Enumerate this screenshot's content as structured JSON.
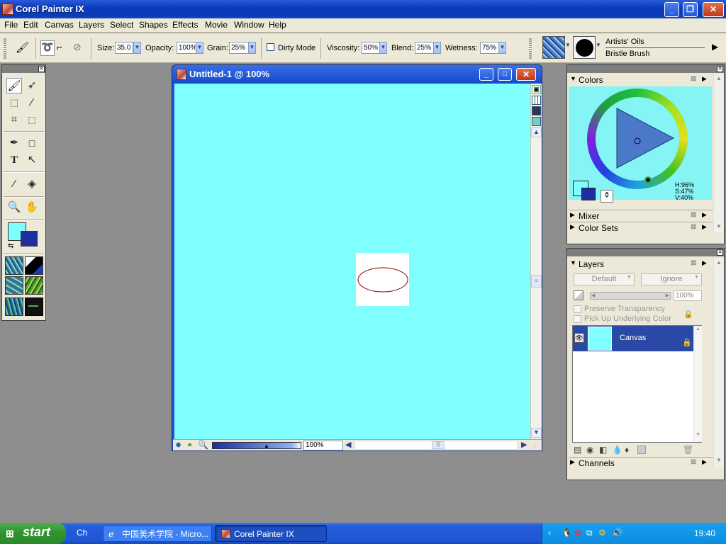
{
  "app": {
    "title": "Corel Painter IX"
  },
  "menu": [
    "File",
    "Edit",
    "Canvas",
    "Layers",
    "Select",
    "Shapes",
    "Effects",
    "Movie",
    "Window",
    "Help"
  ],
  "property_bar": {
    "size_label": "Size:",
    "size_value": "35.0",
    "opacity_label": "Opacity:",
    "opacity_value": "100%",
    "grain_label": "Grain:",
    "grain_value": "25%",
    "dirty_mode_label": "Dirty Mode",
    "viscosity_label": "Viscosity:",
    "viscosity_value": "50%",
    "blend_label": "Blend:",
    "blend_value": "25%",
    "wetness_label": "Wetness:",
    "wetness_value": "75%",
    "brush_category": "Artists' Oils",
    "brush_variant": "Bristle Brush"
  },
  "document": {
    "title": "Untitled-1 @ 100%",
    "zoom": "100%",
    "canvas_color": "#80ffff",
    "ellipse_color": "#8b0000"
  },
  "colors_panel": {
    "title": "Colors",
    "h": "H:96%",
    "s": "S:47%",
    "v": "V:40%",
    "mixer": "Mixer",
    "color_sets": "Color Sets",
    "primary": "#80ffff",
    "secondary": "#1c2ea0"
  },
  "layers_panel": {
    "title": "Layers",
    "composite_method": "Default",
    "composite_depth": "Ignore",
    "opacity": "100%",
    "preserve_transparency": "Preserve Transparency",
    "pick_up_underlying": "Pick Up Underlying Color",
    "layer_name": "Canvas",
    "channels": "Channels"
  },
  "taskbar": {
    "start": "start",
    "quick": "Ch",
    "task1": "中国美术学院 - Micro...",
    "task2": "Corel Painter IX",
    "clock": "19:40"
  }
}
